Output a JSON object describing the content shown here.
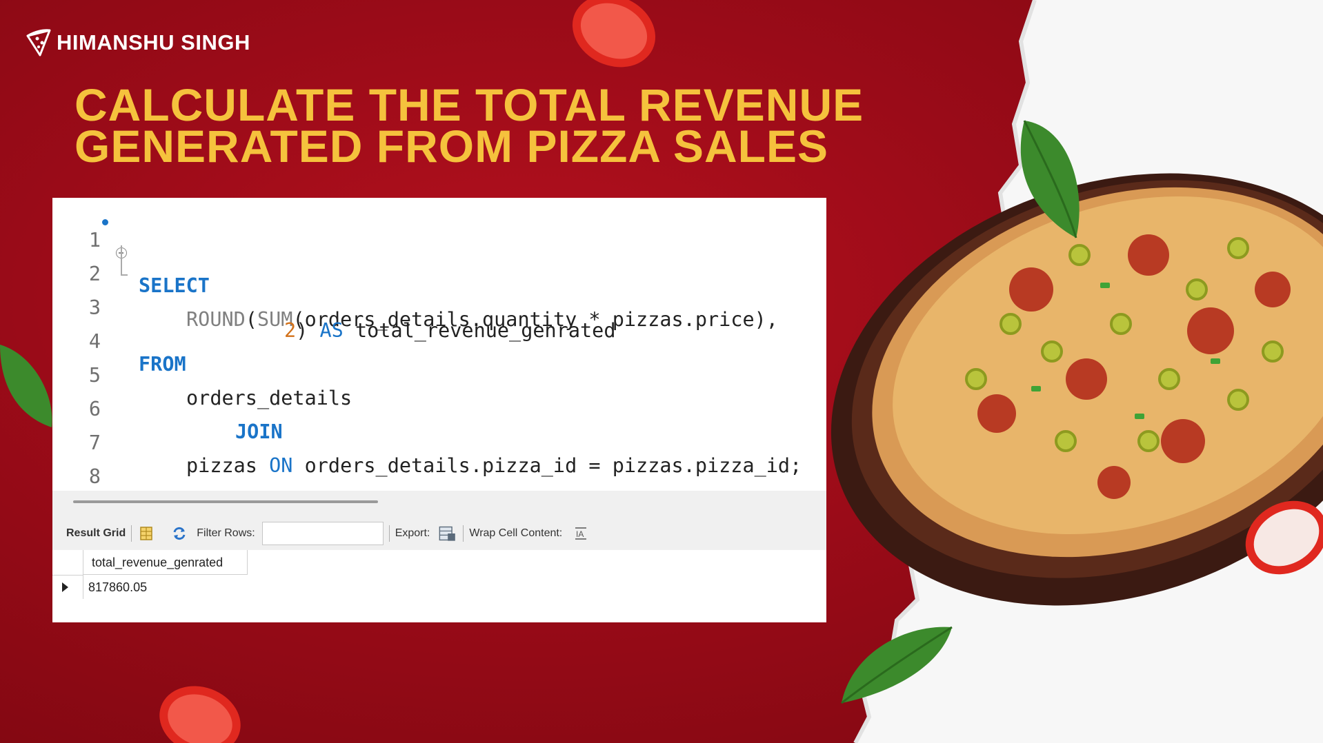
{
  "brand": {
    "name": "HIMANSHU SINGH",
    "icon": "pizza-slice-icon"
  },
  "headline": {
    "line1": "CALCULATE THE TOTAL REVENUE",
    "line2": "GENERATED FROM PIZZA SALES"
  },
  "editor": {
    "line_numbers": [
      "1",
      "2",
      "3",
      "4",
      "5",
      "6",
      "7",
      "8"
    ],
    "line1": {
      "kw": "SELECT"
    },
    "line2": {
      "fn1": "ROUND",
      "p1": "(",
      "fn2": "SUM",
      "rest": "(orders_details.quantity * pizzas.price),"
    },
    "line3": {
      "num": "2",
      "mid": ") ",
      "kw": "AS",
      "rest": " total_revenue_genrated"
    },
    "line4": {
      "kw": "FROM"
    },
    "line5": {
      "text": "orders_details"
    },
    "line6": {
      "kw": "JOIN"
    },
    "line7": {
      "a": "pizzas ",
      "kw": "ON",
      "b": " orders_details.pizza_id = pizzas.pizza_id;"
    }
  },
  "toolbar": {
    "result_grid": "Result Grid",
    "filter_label": "Filter Rows:",
    "filter_value": "",
    "export_label": "Export:",
    "wrap_label": "Wrap Cell Content:"
  },
  "grid": {
    "columns": [
      "total_revenue_genrated"
    ],
    "rows": [
      [
        "817860.05"
      ]
    ]
  },
  "colors": {
    "background_red": "#9a0b18",
    "headline_yellow": "#f5c23d",
    "keyword_blue": "#1a74c8",
    "number_orange": "#d2711a"
  }
}
